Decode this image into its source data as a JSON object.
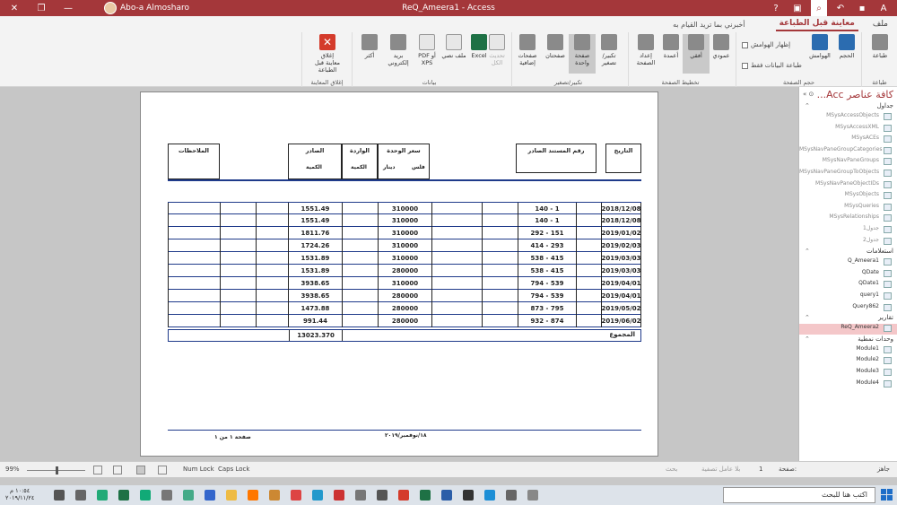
{
  "titlebar": {
    "title": "ReQ_Ameera1 - Access",
    "user": "Abo-a Almosharo"
  },
  "ribbon_tabs": {
    "file": "ملف",
    "print_preview": "معاينة قبل الطباعة",
    "tell_me": "أخبرني بما تريد القيام به"
  },
  "ribbon": {
    "print": "طباعة",
    "size": "الحجم",
    "margins": "الهوامش",
    "show_margins": "إظهار الهوامش",
    "print_data_only": "طباعة البيانات فقط",
    "portrait": "عمودي",
    "landscape": "أفقي",
    "columns": "أعمدة",
    "page_setup": "إعداد الصفحة",
    "zoom": "تكبير/تصغير",
    "one_page": "صفحة واحدة",
    "two_pages": "صفحتان",
    "more_pages": "صفحات إضافية",
    "refresh_all": "تحديث الكل",
    "excel": "Excel",
    "text_file": "ملف نصي",
    "pdf_xps": "PDF أو XPS",
    "email": "بريد إلكتروني",
    "more": "أكثر",
    "close_preview": "إغلاق معاينة قبل الطباعة",
    "g_print": "طباعة",
    "g_page_size": "حجم الصفحة",
    "g_page_layout": "تخطيط الصفحة",
    "g_zoom": "تكبير/تصغير",
    "g_data": "بيانات",
    "g_close": "إغلاق المعاينة"
  },
  "report": {
    "headers": {
      "date": "التاريخ",
      "doc_number": "رقم المستند الصادر",
      "unit_price": "سعر الوحدة",
      "unit_price_sub_fils": "فلس",
      "unit_price_sub_dinar": "دينار",
      "incoming": "الواردة",
      "incoming_sub": "الكمية",
      "outgoing": "الصادر",
      "outgoing_sub": "الكمية",
      "notes": "الملاحظات"
    },
    "rows": [
      {
        "date": "2018/12/08",
        "doc": "140   -   1",
        "price": "310000",
        "qty": "1551.49"
      },
      {
        "date": "2018/12/08",
        "doc": "140   -   1",
        "price": "310000",
        "qty": "1551.49"
      },
      {
        "date": "2019/01/02",
        "doc": "292   -   151",
        "price": "310000",
        "qty": "1811.76"
      },
      {
        "date": "2019/02/03",
        "doc": "414   -   293",
        "price": "310000",
        "qty": "1724.26"
      },
      {
        "date": "2019/03/03",
        "doc": "538   -   415",
        "price": "310000",
        "qty": "1531.89"
      },
      {
        "date": "2019/03/03",
        "doc": "538   -   415",
        "price": "280000",
        "qty": "1531.89"
      },
      {
        "date": "2019/04/01",
        "doc": "794   -   539",
        "price": "310000",
        "qty": "3938.65"
      },
      {
        "date": "2019/04/01",
        "doc": "794   -   539",
        "price": "280000",
        "qty": "3938.65"
      },
      {
        "date": "2019/05/02",
        "doc": "873   -   795",
        "price": "280000",
        "qty": "1473.88"
      },
      {
        "date": "2019/06/02",
        "doc": "932   -   874",
        "price": "280000",
        "qty": "991.44"
      }
    ],
    "total_label": "المجموع",
    "total_value": "13023.370",
    "footer_date": "١٨/نوفمبر/٢٠١٩",
    "footer_page": "صفحة ١ من ١"
  },
  "navpane": {
    "title": "كافة عناصر Acc...",
    "sections": {
      "tables": "جداول",
      "queries": "استعلامات",
      "reports": "تقارير",
      "modules": "وحدات نمطية"
    },
    "tables": [
      "MSysAccessObjects",
      "MSysAccessXML",
      "MSysACEs",
      "MSysNavPaneGroupCategories",
      "MSysNavPaneGroups",
      "MSysNavPaneGroupToObjects",
      "MSysNavPaneObjectIDs",
      "MSysObjects",
      "MSysQueries",
      "MSysRelationships",
      "جدول1",
      "جدول2"
    ],
    "queries": [
      "Q_Ameera1",
      "QDate",
      "QDate1",
      "query1",
      "Query862"
    ],
    "reports": [
      "ReQ_Ameera2"
    ],
    "modules": [
      "Module1",
      "Module2",
      "Module3",
      "Module4"
    ]
  },
  "recnav": {
    "page_label": "صفحة:",
    "page_value": "1",
    "filter": "بلا عامل تصفية",
    "search": "بحث"
  },
  "status": {
    "ready": "جاهز",
    "num_lock": "Num Lock",
    "caps_lock": "Caps Lock",
    "zoom": "99%"
  },
  "taskbar": {
    "search_placeholder": "اكتب هنا للبحث",
    "time": "١٠:٥٤ م",
    "date": "٢٠١٩/١١/٢٤"
  }
}
